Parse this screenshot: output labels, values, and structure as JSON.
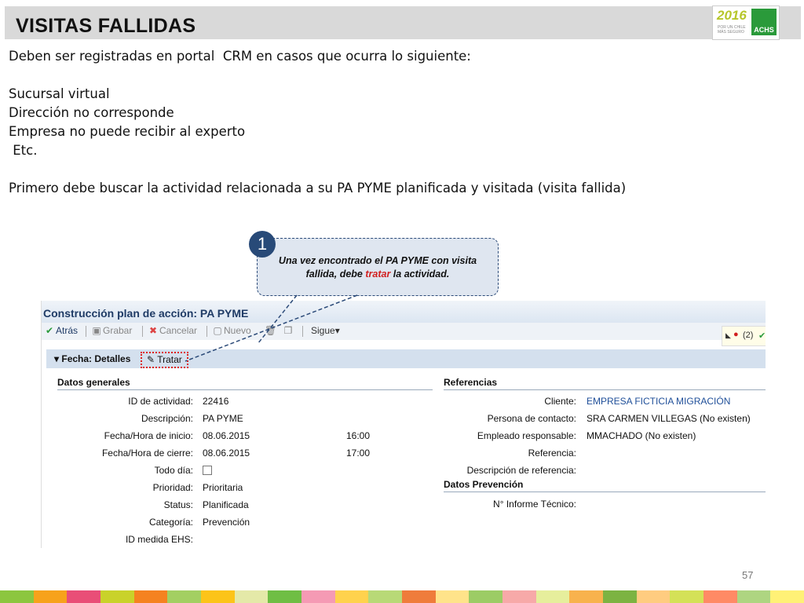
{
  "slide": {
    "title": "VISITAS FALLIDAS",
    "logo_year": "2016",
    "logo_tagline": "POR UN CHILE MÁS SEGURO",
    "logo_brand": "ACHS",
    "page_number": "57",
    "intro_lines": [
      "Deben ser registradas en portal  CRM en casos que ocurra lo siguiente:",
      "",
      "Sucursal virtual",
      "Dirección no corresponde",
      "Empresa no puede recibir al experto",
      " Etc.",
      "",
      "Primero debe buscar la actividad relacionada a su PA PYME planificada y visitada (visita fallida)"
    ],
    "callout": {
      "number": "1",
      "text_before": "Una vez encontrado el PA PYME con visita fallida,  debe ",
      "text_highlight": "tratar",
      "text_after": " la actividad.",
      "highlight_color": "#d12020"
    },
    "stripe_colors": [
      "#8cc63f",
      "#f7a21b",
      "#e94e77",
      "#c9d22a",
      "#f58220",
      "#a3cf62",
      "#fcc419",
      "#e4e9a8",
      "#6fbe44",
      "#f59ab4",
      "#ffd24d",
      "#b8d977",
      "#ef7c3b",
      "#ffe38a",
      "#9ccc65",
      "#f7a9a8",
      "#e6ee9c",
      "#f8b24d",
      "#7cb342",
      "#ffcc80",
      "#d4e157",
      "#ff8a65",
      "#aed581",
      "#fff176"
    ]
  },
  "crm": {
    "window_title": "Construcción plan de acción: PA PYME",
    "toolbar": {
      "back": "Atrás",
      "save": "Grabar",
      "cancel": "Cancelar",
      "new": "Nuevo",
      "next": "Sigue"
    },
    "alert_count": "(2)",
    "section_label": "Fecha: Detalles",
    "tratar_button": "Tratar",
    "general": {
      "heading": "Datos generales",
      "fields": [
        {
          "label": "ID de actividad:",
          "value": "22416",
          "extra": ""
        },
        {
          "label": "Descripción:",
          "value": "PA PYME",
          "extra": ""
        },
        {
          "label": "Fecha/Hora de inicio:",
          "value": "08.06.2015",
          "extra": "16:00"
        },
        {
          "label": "Fecha/Hora de cierre:",
          "value": "08.06.2015",
          "extra": "17:00"
        },
        {
          "label": "Todo día:",
          "value": "",
          "extra": ""
        },
        {
          "label": "Prioridad:",
          "value": "Prioritaria",
          "extra": ""
        },
        {
          "label": "Status:",
          "value": "Planificada",
          "extra": ""
        },
        {
          "label": "Categoría:",
          "value": "Prevención",
          "extra": ""
        },
        {
          "label": "ID medida EHS:",
          "value": "",
          "extra": ""
        }
      ]
    },
    "references": {
      "heading": "Referencias",
      "fields": [
        {
          "label": "Cliente:",
          "value": "EMPRESA FICTICIA MIGRACIÓN"
        },
        {
          "label": "Persona de contacto:",
          "value": "SRA CARMEN VILLEGAS (No existen)"
        },
        {
          "label": "Empleado responsable:",
          "value": "MMACHADO (No existen)"
        },
        {
          "label": "Referencia:",
          "value": ""
        },
        {
          "label": "Descripción de referencia:",
          "value": ""
        }
      ]
    },
    "prevention": {
      "heading": "Datos Prevención",
      "fields": [
        {
          "label": "N° Informe Técnico:",
          "value": ""
        }
      ]
    }
  }
}
